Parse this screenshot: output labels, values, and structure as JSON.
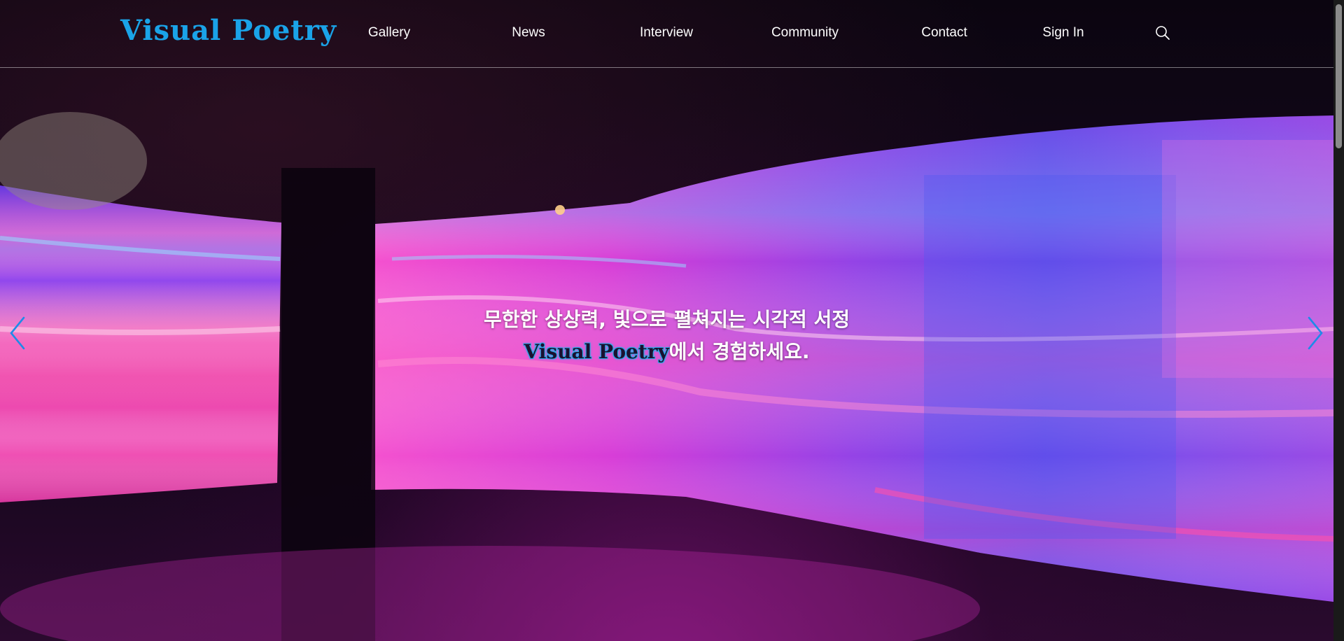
{
  "brand": {
    "logo_text": "Visual Poetry",
    "logo_color": "#1aa3e8"
  },
  "nav": {
    "items": [
      {
        "label": "Gallery"
      },
      {
        "label": "News"
      },
      {
        "label": "Interview"
      },
      {
        "label": "Community"
      },
      {
        "label": "Contact"
      },
      {
        "label": "Sign In"
      }
    ],
    "search_icon": "search-icon"
  },
  "hero": {
    "line1": "무한한 상상력, 빛으로 펼쳐지는 시각적 서정",
    "line2_brand": "Visual Poetry",
    "line2_rest": "에서 경험하세요.",
    "background": "curved LED wall light installation in magenta, pink and violet",
    "accent_color": "#2aa8e8"
  },
  "carousel": {
    "prev_icon": "chevron-left-icon",
    "next_icon": "chevron-right-icon"
  }
}
